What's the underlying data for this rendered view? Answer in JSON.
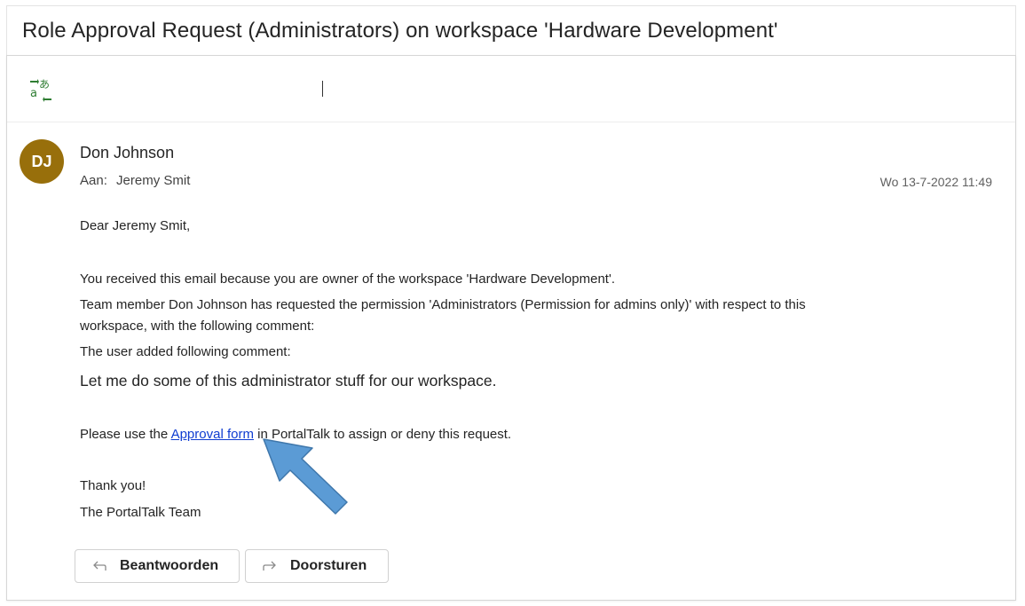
{
  "subject": "Role Approval Request (Administrators) on workspace 'Hardware Development'",
  "message": {
    "avatar_initials": "DJ",
    "avatar_color": "#986f0b",
    "sender": "Don Johnson",
    "to_label": "Aan:",
    "to_name": "Jeremy Smit",
    "date": "Wo 13-7-2022 11:49",
    "body": {
      "greeting": "Dear Jeremy Smit,",
      "line1": "You received this email because you are owner of the workspace 'Hardware Development'.",
      "line2a": "Team member Don Johnson has requested the permission 'Administrators (Permission for admins only)' with respect to this",
      "line2b": "workspace, with the following comment:",
      "line3": "The user added following comment:",
      "comment": "Let me do some of this administrator stuff for our workspace.",
      "approval_prefix": "Please use the ",
      "approval_link": "Approval form",
      "approval_suffix": " in PortalTalk to assign or deny this request.",
      "thanks": "Thank you!",
      "signature": "The PortalTalk Team"
    }
  },
  "actions": {
    "reply_label": "Beantwoorden",
    "forward_label": "Doorsturen"
  },
  "icons": {
    "translate": "translate-icon",
    "reply": "reply-arrow-icon",
    "forward": "forward-arrow-icon",
    "annotation": "pointer-arrow-annotation"
  },
  "colors": {
    "link": "#0f3dd1",
    "annotation_arrow": "#5b9bd5",
    "translate_icon": "#2e7d32"
  }
}
